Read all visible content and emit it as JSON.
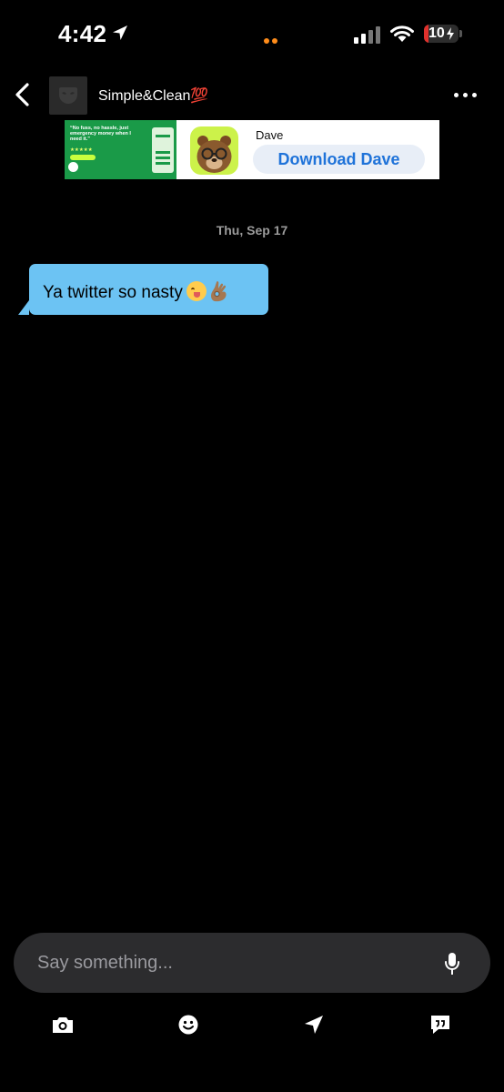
{
  "status_bar": {
    "time": "4:42",
    "battery_level": "10",
    "battery_percent": 10,
    "icons": [
      "location-arrow-icon",
      "cellular-signal-icon",
      "wifi-icon",
      "battery-charging-icon"
    ],
    "colors": {
      "battery_low": "#e0312c",
      "privacy_dots": "#ff8c1a"
    }
  },
  "header": {
    "contact_name": "Simple&Clean💯",
    "icons": [
      "chevron-left-icon",
      "more-horizontal-icon"
    ]
  },
  "ad": {
    "quote": "“No fuss, no hassle, just emergency money when I need it.”",
    "stars": "★★★★★",
    "app_name": "Dave",
    "cta": "Download Dave",
    "colors": {
      "brand_green": "#1a9a48",
      "icon_lime": "#ccf24a",
      "cta_blue": "#1f73d9"
    }
  },
  "conversation": {
    "date_label": "Thu, Sep 17",
    "messages": [
      {
        "text": "Ya twitter so nasty",
        "emojis": [
          "face-savoring-food",
          "ok-hand-medium-skin-tone"
        ],
        "incoming": true
      }
    ],
    "colors": {
      "incoming_bubble": "#6cc3f3"
    }
  },
  "composer": {
    "placeholder": "Say something...",
    "value": ""
  },
  "toolbar": {
    "icons": [
      "camera-icon",
      "smiley-icon",
      "location-send-icon",
      "saved-phrases-icon"
    ]
  }
}
